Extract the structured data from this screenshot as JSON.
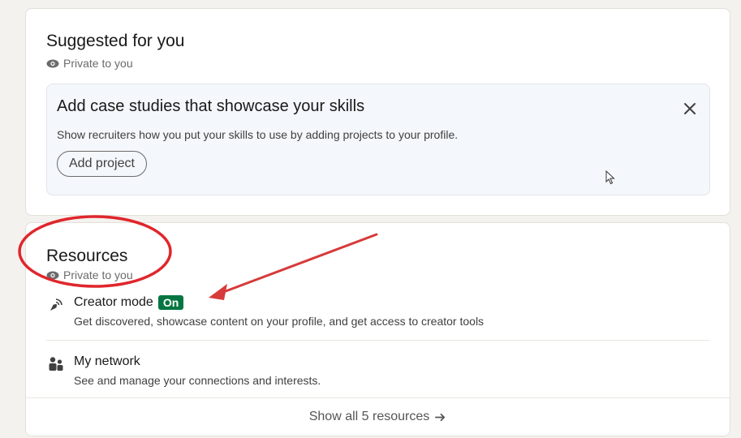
{
  "suggested": {
    "title": "Suggested for you",
    "privacy": "Private to you",
    "card": {
      "heading": "Add case studies that showcase your skills",
      "description": "Show recruiters how you put your skills to use by adding projects to your profile.",
      "button_label": "Add project",
      "close_icon": "close-icon"
    }
  },
  "resources": {
    "title": "Resources",
    "privacy": "Private to you",
    "items": [
      {
        "icon": "broadcast-icon",
        "title": "Creator mode",
        "badge": "On",
        "description": "Get discovered, showcase content on your profile, and get access to creator tools"
      },
      {
        "icon": "people-icon",
        "title": "My network",
        "description": "See and manage your connections and interests."
      }
    ],
    "show_all": "Show all 5 resources",
    "show_all_icon": "arrow-right-icon"
  },
  "colors": {
    "badge_green": "#057642",
    "annotation_red": "#e0262c",
    "background": "#f4f2ee"
  }
}
